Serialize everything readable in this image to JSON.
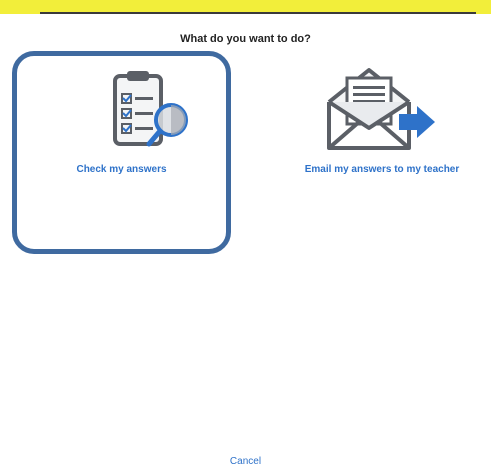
{
  "dialog": {
    "prompt": "What do you want to do?",
    "options": [
      {
        "label": "Check my answers",
        "icon": "clipboard-magnifier-icon",
        "selected": true
      },
      {
        "label": "Email my answers to my teacher",
        "icon": "envelope-send-icon",
        "selected": false
      }
    ],
    "cancel_label": "Cancel"
  },
  "colors": {
    "accent": "#2e72c9",
    "selection_border": "#3f6aa0",
    "top_strip": "#f2ee3a"
  }
}
